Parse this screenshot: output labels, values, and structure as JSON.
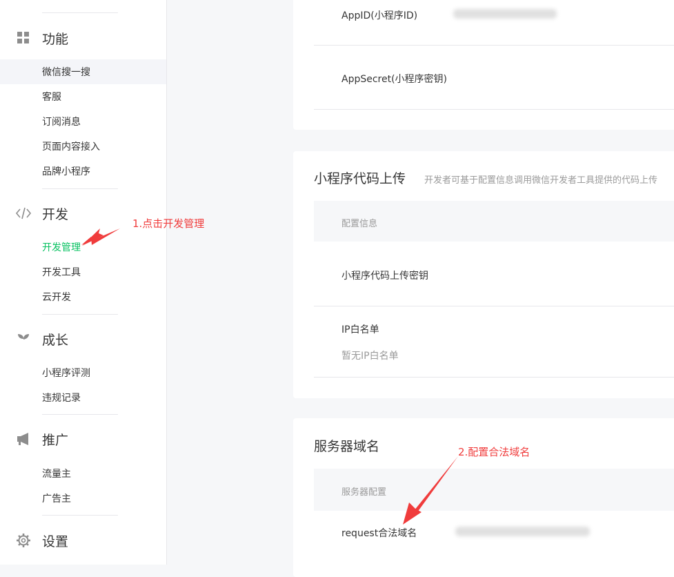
{
  "sidebar": {
    "sections": {
      "features": {
        "label": "功能",
        "icon": "grid-icon",
        "items": [
          "微信搜一搜",
          "客服",
          "订阅消息",
          "页面内容接入",
          "品牌小程序"
        ]
      },
      "dev": {
        "label": "开发",
        "icon": "code-icon",
        "items": [
          "开发管理",
          "开发工具",
          "云开发"
        ]
      },
      "growth": {
        "label": "成长",
        "icon": "sprout-icon",
        "items": [
          "小程序评测",
          "违规记录"
        ]
      },
      "promote": {
        "label": "推广",
        "icon": "megaphone-icon",
        "items": [
          "流量主",
          "广告主"
        ]
      },
      "settings": {
        "label": "设置",
        "icon": "gear-icon"
      }
    }
  },
  "main": {
    "app_card": {
      "appid_label": "AppID(小程序ID)",
      "appsecret_label": "AppSecret(小程序密钥)"
    },
    "upload_card": {
      "title": "小程序代码上传",
      "subtitle": "开发者可基于配置信息调用微信开发者工具提供的代码上传",
      "header": "配置信息",
      "key_label": "小程序代码上传密钥",
      "ip_label": "IP白名单",
      "ip_empty": "暂无IP白名单"
    },
    "domain_card": {
      "title": "服务器域名",
      "header": "服务器配置",
      "request_label": "request合法域名"
    }
  },
  "annotations": {
    "step1": "1.点击开发管理",
    "step2": "2.配置合法域名",
    "color": "#f03c3c"
  },
  "colors": {
    "active": "#07c160",
    "background": "#f6f7f9"
  }
}
